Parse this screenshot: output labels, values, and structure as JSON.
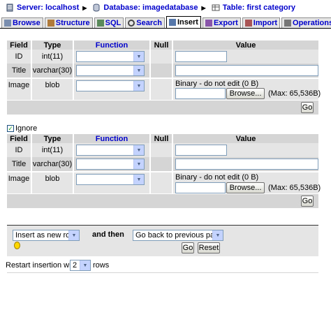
{
  "breadcrumb": {
    "server": "Server: localhost",
    "database": "Database: imagedatabase",
    "table": "Table: first category"
  },
  "tabs": [
    {
      "label": "Browse",
      "icon": "browse-icon"
    },
    {
      "label": "Structure",
      "icon": "structure-icon"
    },
    {
      "label": "SQL",
      "icon": "sql-icon"
    },
    {
      "label": "Search",
      "icon": "search-icon"
    },
    {
      "label": "Insert",
      "icon": "insert-icon",
      "active": true
    },
    {
      "label": "Export",
      "icon": "export-icon"
    },
    {
      "label": "Import",
      "icon": "import-icon"
    },
    {
      "label": "Operations",
      "icon": "operations-icon"
    }
  ],
  "columns": {
    "field": "Field",
    "type": "Type",
    "function": "Function",
    "null": "Null",
    "value": "Value"
  },
  "form1": {
    "rows": [
      {
        "field": "ID",
        "type": "int(11)"
      },
      {
        "field": "Title",
        "type": "varchar(30)"
      },
      {
        "field": "Image",
        "type": "blob",
        "binary_note": "Binary - do not edit (0 B)",
        "browse": "Browse...",
        "max": "(Max: 65,536B)"
      }
    ],
    "go": "Go"
  },
  "ignore_label": "Ignore",
  "form2": {
    "rows": [
      {
        "field": "ID",
        "type": "int(11)"
      },
      {
        "field": "Title",
        "type": "varchar(30)"
      },
      {
        "field": "Image",
        "type": "blob",
        "binary_note": "Binary - do not edit (0 B)",
        "browse": "Browse...",
        "max": "(Max: 65,536B)"
      }
    ],
    "go": "Go"
  },
  "after": {
    "insert_mode": "Insert as new row",
    "and_then": "and then",
    "next_action": "Go back to previous page",
    "go": "Go",
    "reset": "Reset"
  },
  "restart": {
    "prefix": "Restart insertion with",
    "count": "2",
    "suffix": "rows"
  }
}
